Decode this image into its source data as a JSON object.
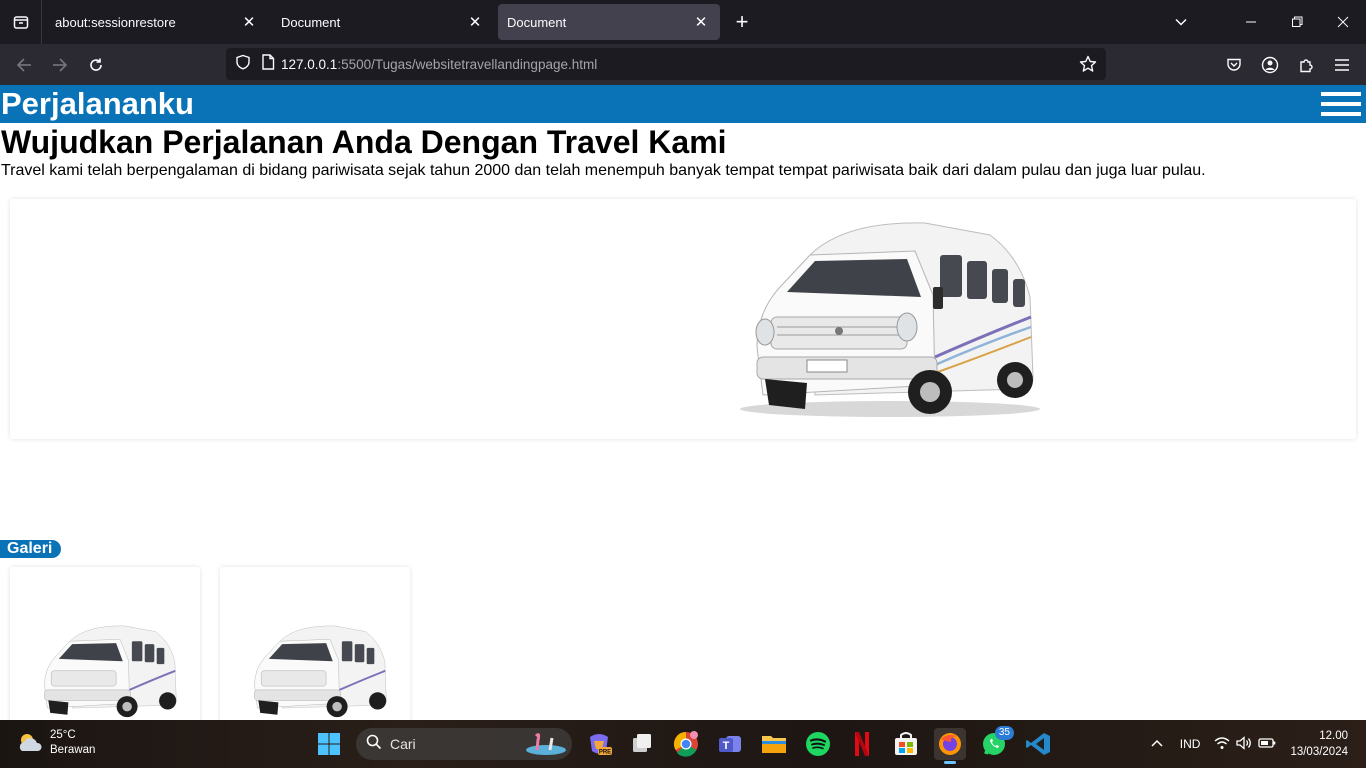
{
  "browser": {
    "tabs": [
      {
        "label": "about:sessionrestore",
        "active": false
      },
      {
        "label": "Document",
        "active": false
      },
      {
        "label": "Document",
        "active": true
      }
    ],
    "url_host": "127.0.0.1",
    "url_rest": ":5500/Tugas/websitetravellandingpage.html"
  },
  "page": {
    "brand": "Perjalananku",
    "hero_title": "Wujudkan Perjalanan Anda Dengan Travel Kami",
    "hero_text": "Travel kami telah berpengalaman di bidang pariwisata sejak tahun 2000 dan telah menempuh banyak tempat tempat pariwisata baik dari dalam pulau dan juga luar pulau.",
    "gallery_label": "Galeri",
    "accent_color": "#0a73b7"
  },
  "taskbar": {
    "weather_temp": "25°C",
    "weather_desc": "Berawan",
    "search_placeholder": "Cari",
    "whatsapp_badge": "35",
    "language": "IND",
    "time": "12.00",
    "date": "13/03/2024"
  }
}
